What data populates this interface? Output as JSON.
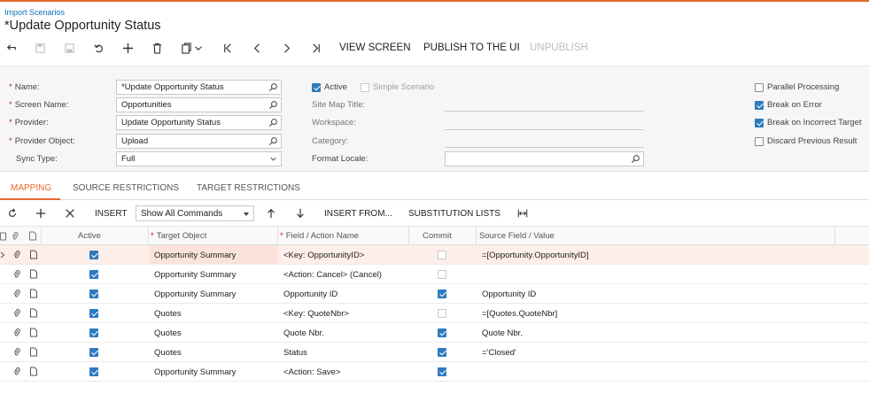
{
  "breadcrumb": "Import Scenarios",
  "title": "*Update Opportunity Status",
  "toolbar": {
    "view_screen": "VIEW SCREEN",
    "publish": "PUBLISH TO THE UI",
    "unpublish": "UNPUBLISH"
  },
  "form": {
    "name_label": "Name:",
    "name_value": "*Update Opportunity Status",
    "screen_label": "Screen Name:",
    "screen_value": "Opportunities",
    "provider_label": "Provider:",
    "provider_value": "Update Opportunity Status",
    "provider_object_label": "Provider Object:",
    "provider_object_value": "Upload",
    "sync_label": "Sync Type:",
    "sync_value": "Full",
    "active_label": "Active",
    "simple_label": "Simple Scenario",
    "sitemap_label": "Site Map Title:",
    "workspace_label": "Workspace:",
    "category_label": "Category:",
    "format_label": "Format Locale:",
    "parallel_label": "Parallel Processing",
    "break_error_label": "Break on Error",
    "break_target_label": "Break on Incorrect Target",
    "discard_label": "Discard Previous Result"
  },
  "tabs": {
    "mapping": "MAPPING",
    "source": "SOURCE RESTRICTIONS",
    "target": "TARGET RESTRICTIONS"
  },
  "grid_toolbar": {
    "insert": "INSERT",
    "show_commands": "Show All Commands",
    "insert_from": "INSERT FROM...",
    "substitution": "SUBSTITUTION LISTS"
  },
  "grid": {
    "headers": {
      "active": "Active",
      "target_object": "Target Object",
      "field_action": "Field / Action Name",
      "commit": "Commit",
      "source": "Source Field / Value"
    },
    "rows": [
      {
        "active": true,
        "target": "Opportunity Summary",
        "field": "<Key: OpportunityID>",
        "commit": false,
        "source": "=[Opportunity.OpportunityID]"
      },
      {
        "active": true,
        "target": "Opportunity Summary",
        "field": "<Action: Cancel> (Cancel)",
        "commit": false,
        "source": ""
      },
      {
        "active": true,
        "target": "Opportunity Summary",
        "field": "Opportunity ID",
        "commit": true,
        "source": "Opportunity ID"
      },
      {
        "active": true,
        "target": "Quotes",
        "field": "<Key: QuoteNbr>",
        "commit": false,
        "source": "=[Quotes.QuoteNbr]"
      },
      {
        "active": true,
        "target": "Quotes",
        "field": "Quote Nbr.",
        "commit": true,
        "source": "Quote Nbr."
      },
      {
        "active": true,
        "target": "Quotes",
        "field": "Status",
        "commit": true,
        "source": "='Closed'"
      },
      {
        "active": true,
        "target": "Opportunity Summary",
        "field": "<Action: Save>",
        "commit": true,
        "source": ""
      }
    ]
  }
}
